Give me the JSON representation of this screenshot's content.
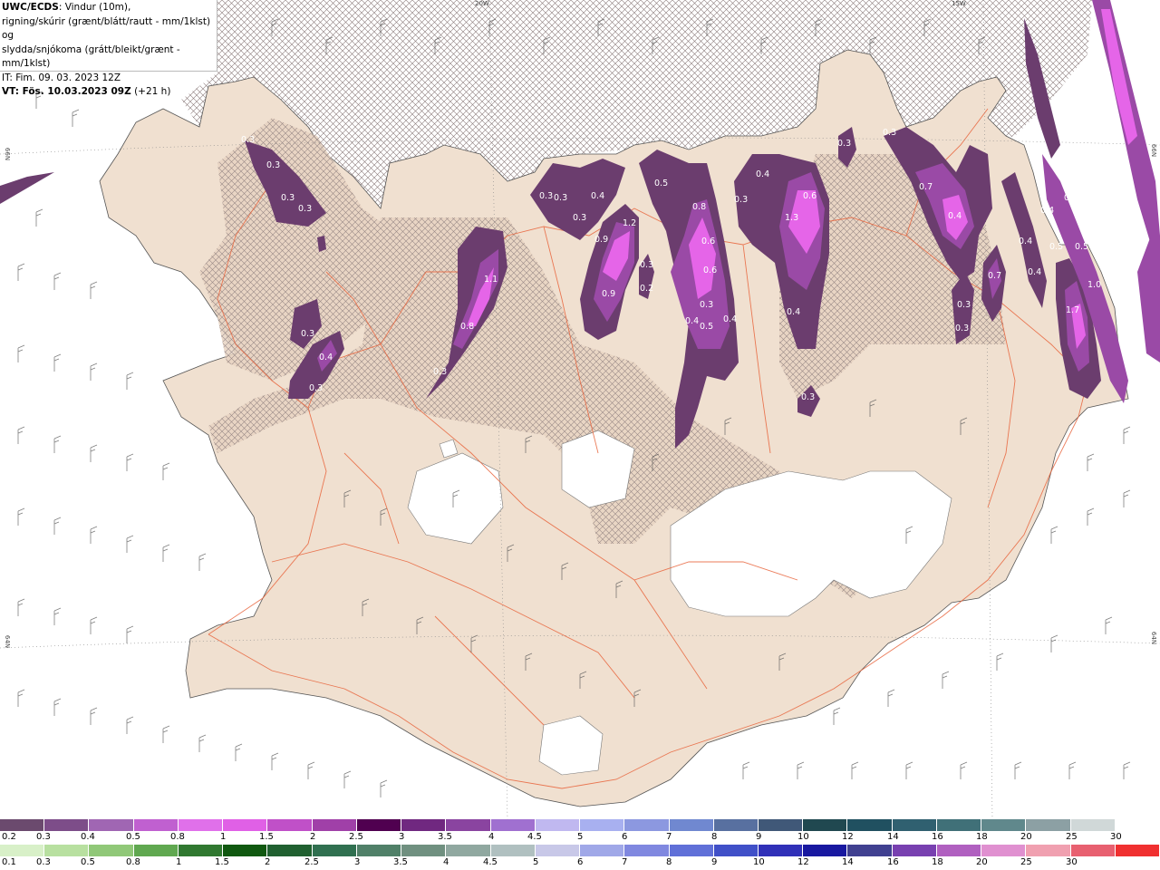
{
  "header": {
    "line1_bold": "UWC/ECDS",
    "line1_rest": ": Vindur (10m),",
    "line2": "rigning/skúrir (grænt/blátt/rautt - mm/1klst) og",
    "line3": "slydda/snjókoma (grátt/bleikt/grænt - mm/1klst)",
    "line4": "IT: Fim. 09. 03. 2023 12Z",
    "line5_bold": "VT: Fös. 10.03.2023 09Z",
    "line5_rest": " (+21 h)"
  },
  "grid_labels": {
    "top_20w": "20W",
    "top_15w": "15W",
    "left_66n": "66N",
    "right_66n": "66N",
    "left_64n": "64N",
    "right_64n": "64N"
  },
  "colors": {
    "land": "#f0e0d0",
    "roads": "#e8643c",
    "snow_dark": "#6b3d6e",
    "snow_mid": "#9a4aa6",
    "snow_bright": "#e565e8",
    "hatch": "#9a8a8a"
  },
  "precip_labels": [
    {
      "v": "0.3"
    },
    {
      "v": "0.3"
    },
    {
      "v": "0.3"
    },
    {
      "v": "0.3"
    },
    {
      "v": "0.4"
    },
    {
      "v": "0.3"
    },
    {
      "v": "0.3"
    },
    {
      "v": "1.1"
    },
    {
      "v": "0.8"
    },
    {
      "v": "0.3"
    },
    {
      "v": "0.3"
    },
    {
      "v": "0.3"
    },
    {
      "v": "0.4"
    },
    {
      "v": "0.3"
    },
    {
      "v": "1.2"
    },
    {
      "v": "0.9"
    },
    {
      "v": "0.9"
    },
    {
      "v": "0.3"
    },
    {
      "v": "0.2"
    },
    {
      "v": "0.5"
    },
    {
      "v": "0.8"
    },
    {
      "v": "0.6"
    },
    {
      "v": "0.6"
    },
    {
      "v": "0.3"
    },
    {
      "v": "0.4"
    },
    {
      "v": "0.5"
    },
    {
      "v": "0.4"
    },
    {
      "v": "0.4"
    },
    {
      "v": "0.3"
    },
    {
      "v": "0.6"
    },
    {
      "v": "1.3"
    },
    {
      "v": "0.4"
    },
    {
      "v": "0.3"
    },
    {
      "v": "0.3"
    },
    {
      "v": "0.3"
    },
    {
      "v": "0.7"
    },
    {
      "v": "0.4"
    },
    {
      "v": "0.7"
    },
    {
      "v": "0.3"
    },
    {
      "v": "0.3"
    },
    {
      "v": "0.4"
    },
    {
      "v": "0.4"
    },
    {
      "v": "0.5"
    },
    {
      "v": "0.4"
    },
    {
      "v": "1.0"
    },
    {
      "v": "1.7"
    },
    {
      "v": "0.4"
    },
    {
      "v": "0.5"
    }
  ],
  "scale_snow": {
    "colors": [
      "#6b4a6e",
      "#7d4d89",
      "#a066b3",
      "#c060d0",
      "#e070ea",
      "#e060e6",
      "#c050c8",
      "#a040a8",
      "#500050",
      "#702880",
      "#8a44a0",
      "#a070d0",
      "#c0b8f0",
      "#a8b0f0",
      "#8c98e0",
      "#7088d0",
      "#5870a0",
      "#405878",
      "#204850",
      "#205060",
      "#306070",
      "#407078",
      "#60888c",
      "#8ca0a4",
      "#d0d8d8",
      "#ffffff"
    ],
    "ticks": [
      "0.2",
      "0.3",
      "0.4",
      "0.5",
      "0.8",
      "1",
      "1.5",
      "2",
      "2.5",
      "3",
      "3.5",
      "4",
      "4.5",
      "5",
      "6",
      "7",
      "8",
      "9",
      "10",
      "12",
      "14",
      "16",
      "18",
      "20",
      "25",
      "30"
    ]
  },
  "scale_rain": {
    "colors": [
      "#d8f0c8",
      "#b8e0a0",
      "#90c878",
      "#60a850",
      "#307830",
      "#105810",
      "#206030",
      "#307050",
      "#508068",
      "#709080",
      "#90a8a0",
      "#b0c0c0",
      "#c8c8e8",
      "#a0a8e8",
      "#8088e0",
      "#6070d8",
      "#4050c8",
      "#3030b8",
      "#1818a0",
      "#404090",
      "#7840b0",
      "#b060c0",
      "#e090d0",
      "#f0a0b0",
      "#e86070",
      "#f03030"
    ],
    "ticks": [
      "0.1",
      "0.3",
      "0.5",
      "0.8",
      "1",
      "1.5",
      "2",
      "2.5",
      "3",
      "3.5",
      "4",
      "4.5",
      "5",
      "6",
      "7",
      "8",
      "9",
      "10",
      "12",
      "14",
      "16",
      "18",
      "20",
      "25",
      "30"
    ]
  }
}
